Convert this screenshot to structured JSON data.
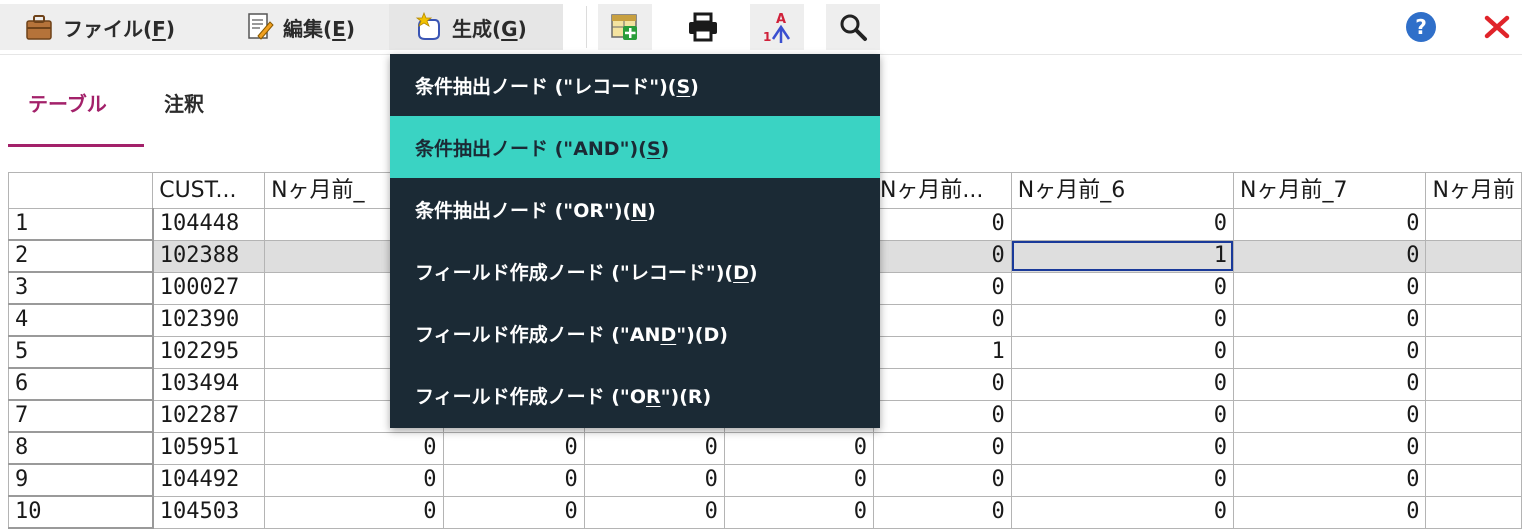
{
  "menubar": {
    "file": {
      "label": "ファイル(",
      "mnemonic": "F",
      "suffix": ")"
    },
    "edit": {
      "label": "編集(",
      "mnemonic": "E",
      "suffix": ")"
    },
    "generate": {
      "label": "生成(",
      "mnemonic": "G",
      "suffix": ")"
    }
  },
  "icons": {
    "file": "briefcase-icon",
    "edit": "edit-document-icon",
    "generate": "generate-wand-icon",
    "tool1": "add-to-stream-icon",
    "tool2": "print-icon",
    "tool3": "sort-icon",
    "tool4": "search-icon",
    "help": "help-icon",
    "close": "close-icon"
  },
  "colors": {
    "accent": "#a3216a",
    "menu_bg": "#1b2a35",
    "menu_highlight": "#3ad3c3",
    "help_blue": "#2f6fc9",
    "close_red": "#e0242a"
  },
  "tabs": {
    "table": "テーブル",
    "notes": "注釈"
  },
  "generate_menu": {
    "items": [
      {
        "pre": "条件抽出ノード (\"レコード\")(",
        "u": "S",
        "post": ")"
      },
      {
        "pre": "条件抽出ノード (\"AND\")(",
        "u": "S",
        "post": ")"
      },
      {
        "pre": "条件抽出ノード (\"OR\")(",
        "u": "N",
        "post": ")"
      },
      {
        "pre": "フィールド作成ノード (\"レコード\")(",
        "u": "D",
        "post": ")"
      },
      {
        "pre": "フィールド作成ノード (\"AN",
        "u": "D",
        "post": "\")(D)"
      },
      {
        "pre": "フィールド作成ノード (\"O",
        "u": "R",
        "post": "\")(R)"
      }
    ]
  },
  "table": {
    "headers": [
      "",
      "CUST...",
      "Nヶ月前_",
      "",
      "",
      "",
      "Nヶ月前...",
      "Nヶ月前_6",
      "Nヶ月前_7",
      "Nヶ月前"
    ],
    "rows": [
      {
        "n": "1",
        "id": "104448",
        "v": [
          "",
          "",
          "",
          "",
          "0",
          "0",
          "0",
          ""
        ]
      },
      {
        "n": "2",
        "id": "102388",
        "v": [
          "",
          "",
          "",
          "",
          "0",
          "1",
          "0",
          ""
        ]
      },
      {
        "n": "3",
        "id": "100027",
        "v": [
          "",
          "",
          "",
          "",
          "0",
          "0",
          "0",
          ""
        ]
      },
      {
        "n": "4",
        "id": "102390",
        "v": [
          "",
          "",
          "",
          "",
          "0",
          "0",
          "0",
          ""
        ]
      },
      {
        "n": "5",
        "id": "102295",
        "v": [
          "",
          "",
          "",
          "",
          "1",
          "0",
          "0",
          ""
        ]
      },
      {
        "n": "6",
        "id": "103494",
        "v": [
          "",
          "",
          "",
          "",
          "0",
          "0",
          "0",
          ""
        ]
      },
      {
        "n": "7",
        "id": "102287",
        "v": [
          "",
          "",
          "",
          "",
          "0",
          "0",
          "0",
          ""
        ]
      },
      {
        "n": "8",
        "id": "105951",
        "v": [
          "0",
          "0",
          "0",
          "0",
          "0",
          "0",
          "0",
          ""
        ]
      },
      {
        "n": "9",
        "id": "104492",
        "v": [
          "0",
          "0",
          "0",
          "0",
          "0",
          "0",
          "0",
          ""
        ]
      },
      {
        "n": "10",
        "id": "104503",
        "v": [
          "0",
          "0",
          "0",
          "0",
          "0",
          "0",
          "0",
          ""
        ]
      }
    ]
  }
}
